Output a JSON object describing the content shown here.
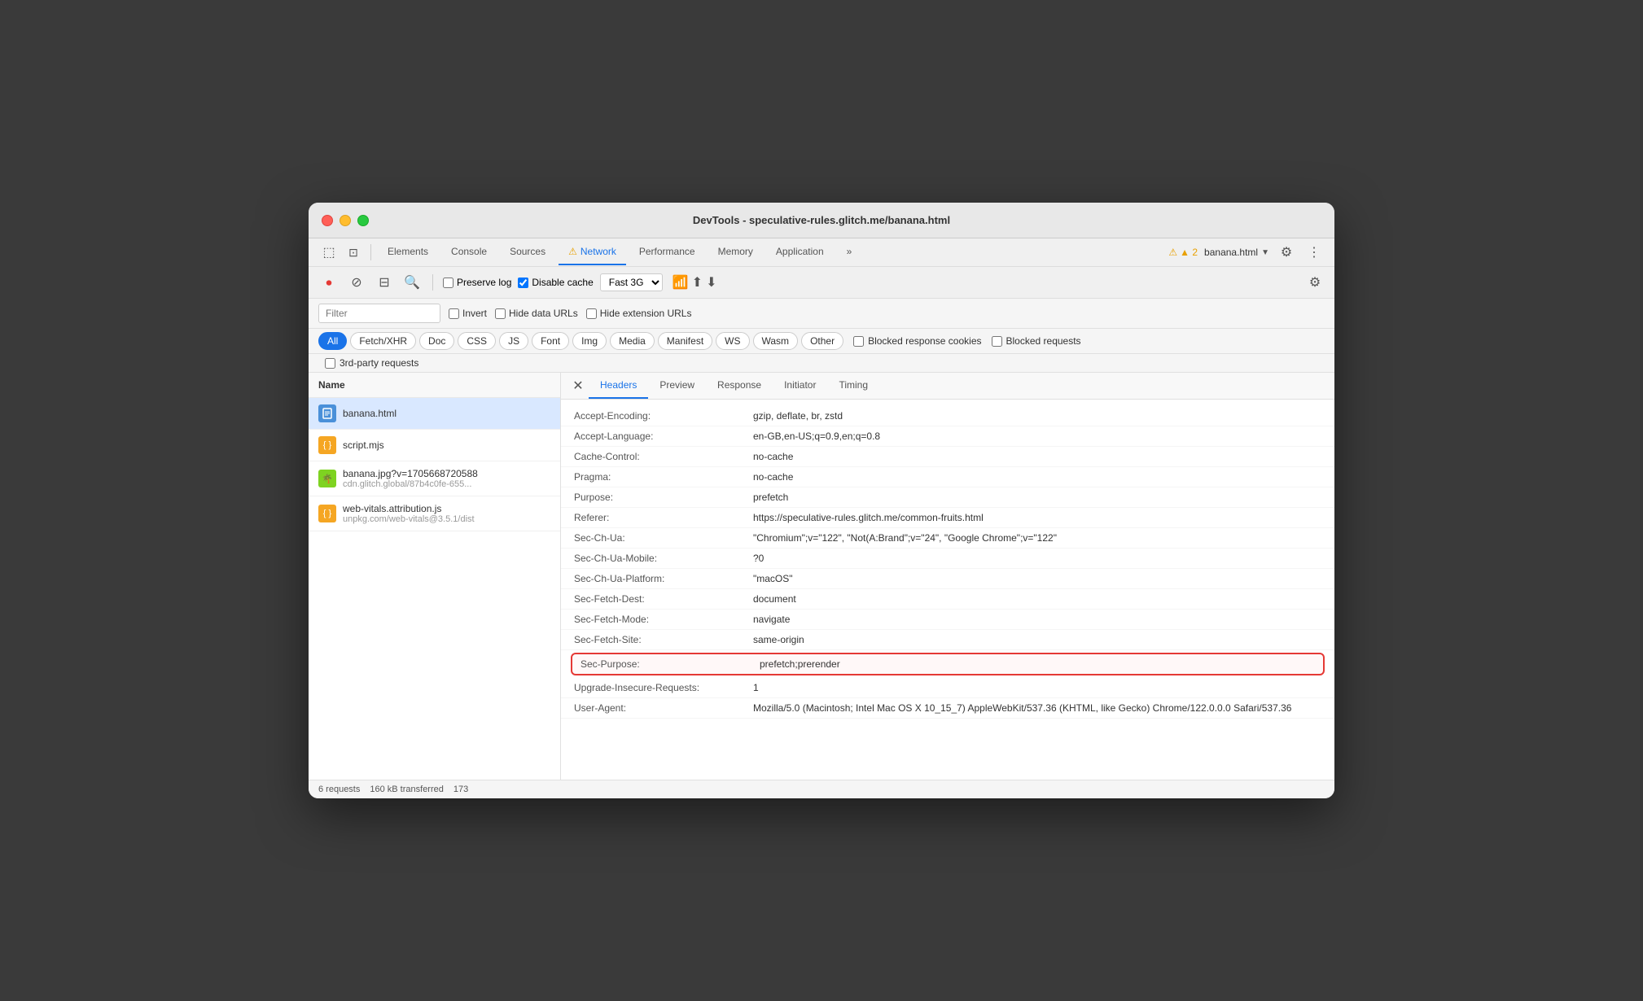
{
  "window": {
    "title": "DevTools - speculative-rules.glitch.me/banana.html"
  },
  "tabs": [
    {
      "label": "Elements",
      "active": false
    },
    {
      "label": "Console",
      "active": false
    },
    {
      "label": "Sources",
      "active": false
    },
    {
      "label": "⚠ Network",
      "active": true
    },
    {
      "label": "Performance",
      "active": false
    },
    {
      "label": "Memory",
      "active": false
    },
    {
      "label": "Application",
      "active": false
    },
    {
      "label": "»",
      "active": false
    }
  ],
  "toolbar": {
    "warning_count": "▲ 2",
    "current_page": "banana.html",
    "preserve_log": "Preserve log",
    "disable_cache": "Disable cache",
    "throttle": "Fast 3G"
  },
  "filter": {
    "placeholder": "Filter",
    "invert": "Invert",
    "hide_data_urls": "Hide data URLs",
    "hide_extension_urls": "Hide extension URLs"
  },
  "type_filters": [
    {
      "label": "All",
      "active": true
    },
    {
      "label": "Fetch/XHR",
      "active": false
    },
    {
      "label": "Doc",
      "active": false
    },
    {
      "label": "CSS",
      "active": false
    },
    {
      "label": "JS",
      "active": false
    },
    {
      "label": "Font",
      "active": false
    },
    {
      "label": "Img",
      "active": false
    },
    {
      "label": "Media",
      "active": false
    },
    {
      "label": "Manifest",
      "active": false
    },
    {
      "label": "WS",
      "active": false
    },
    {
      "label": "Wasm",
      "active": false
    },
    {
      "label": "Other",
      "active": false
    }
  ],
  "extra_filters": {
    "blocked_response_cookies": "Blocked response cookies",
    "blocked_requests": "Blocked requests"
  },
  "third_party": "3rd-party requests",
  "file_list_header": "Name",
  "files": [
    {
      "name": "banana.html",
      "url": "",
      "icon_type": "html",
      "active": true
    },
    {
      "name": "script.mjs",
      "url": "",
      "icon_type": "js",
      "active": false
    },
    {
      "name": "banana.jpg?v=1705668720588",
      "url": "cdn.glitch.global/87b4c0fe-655...",
      "icon_type": "img",
      "active": false
    },
    {
      "name": "web-vitals.attribution.js",
      "url": "unpkg.com/web-vitals@3.5.1/dist",
      "icon_type": "js",
      "active": false
    }
  ],
  "detail_tabs": [
    {
      "label": "Headers",
      "active": true
    },
    {
      "label": "Preview",
      "active": false
    },
    {
      "label": "Response",
      "active": false
    },
    {
      "label": "Initiator",
      "active": false
    },
    {
      "label": "Timing",
      "active": false
    }
  ],
  "headers": [
    {
      "name": "Accept-Encoding:",
      "value": "gzip, deflate, br, zstd",
      "highlighted": false
    },
    {
      "name": "Accept-Language:",
      "value": "en-GB,en-US;q=0.9,en;q=0.8",
      "highlighted": false
    },
    {
      "name": "Cache-Control:",
      "value": "no-cache",
      "highlighted": false
    },
    {
      "name": "Pragma:",
      "value": "no-cache",
      "highlighted": false
    },
    {
      "name": "Purpose:",
      "value": "prefetch",
      "highlighted": false
    },
    {
      "name": "Referer:",
      "value": "https://speculative-rules.glitch.me/common-fruits.html",
      "highlighted": false
    },
    {
      "name": "Sec-Ch-Ua:",
      "value": "\"Chromium\";v=\"122\", \"Not(A:Brand\";v=\"24\", \"Google Chrome\";v=\"122\"",
      "highlighted": false
    },
    {
      "name": "Sec-Ch-Ua-Mobile:",
      "value": "?0",
      "highlighted": false
    },
    {
      "name": "Sec-Ch-Ua-Platform:",
      "value": "\"macOS\"",
      "highlighted": false
    },
    {
      "name": "Sec-Fetch-Dest:",
      "value": "document",
      "highlighted": false
    },
    {
      "name": "Sec-Fetch-Mode:",
      "value": "navigate",
      "highlighted": false
    },
    {
      "name": "Sec-Fetch-Site:",
      "value": "same-origin",
      "highlighted": false
    },
    {
      "name": "Sec-Purpose:",
      "value": "prefetch;prerender",
      "highlighted": true
    },
    {
      "name": "Upgrade-Insecure-Requests:",
      "value": "1",
      "highlighted": false
    },
    {
      "name": "User-Agent:",
      "value": "Mozilla/5.0 (Macintosh; Intel Mac OS X 10_15_7) AppleWebKit/537.36 (KHTML, like Gecko) Chrome/122.0.0.0 Safari/537.36",
      "highlighted": false
    }
  ],
  "status_bar": {
    "requests": "6 requests",
    "transferred": "160 kB transferred",
    "other": "173"
  }
}
